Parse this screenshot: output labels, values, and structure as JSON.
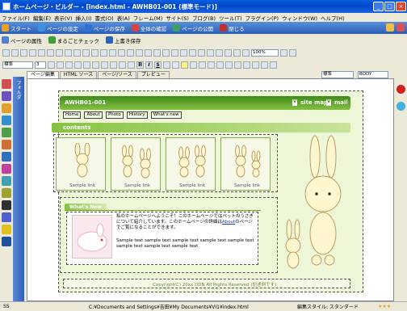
{
  "window": {
    "title": "ホームページ・ビルダー - [index.html - AWHB01-001 (標準モード)]",
    "controls": [
      "_",
      "□",
      "×"
    ]
  },
  "menu": [
    "ファイル(F)",
    "編集(E)",
    "表示(V)",
    "挿入(I)",
    "書式(O)",
    "表(A)",
    "フレーム(M)",
    "サイト(S)",
    "ブログ(B)",
    "ツール(T)",
    "プラグイン(P)",
    "ウィンドウ(W)",
    "ヘルプ(H)"
  ],
  "commands": [
    {
      "label": "スタート",
      "icon": "home-icon",
      "color": "#f0a020"
    },
    {
      "label": "ページの設定",
      "icon": "page-settings-icon",
      "color": "#4090e0"
    },
    {
      "label": "ページの保存",
      "icon": "save-icon",
      "color": "#3070d0"
    },
    {
      "label": "全体の確認",
      "icon": "preview-icon",
      "color": "#e04040"
    },
    {
      "label": "ページの公開",
      "icon": "publish-icon",
      "color": "#40a060"
    },
    {
      "label": "閉じる",
      "icon": "close-doc-icon",
      "color": "#c03030"
    }
  ],
  "commands2": [
    {
      "label": "ページの属性",
      "icon": "page-attr-icon",
      "color": "#5080d0"
    },
    {
      "label": "まるごとチェック",
      "icon": "check-icon",
      "color": "#40a040"
    },
    {
      "label": "上書き保存",
      "icon": "overwrite-save-icon",
      "color": "#3060c0"
    }
  ],
  "format": {
    "style": "標準",
    "zoom": "100%",
    "font_size": "3",
    "standard": "標準",
    "body": "BODY"
  },
  "editor_tabs": [
    "ページ編集",
    "HTML ソース",
    "ページ/ソース",
    "プレビュー"
  ],
  "side_panel": "フォルダ",
  "page": {
    "site_title": "AWHB01-001",
    "site_links": [
      "site map",
      "mail"
    ],
    "nav": [
      "Home",
      "About",
      "Photo",
      "History",
      "What's new"
    ],
    "contents_label": "contents",
    "thumb_link": "Sample link",
    "whats_new": "What's New",
    "intro": "私のホームページへようこそ！このホームページではペットのうさぎについて紹介しています。このホームページの詳細は",
    "intro_link": "About",
    "intro_end": "のページでご覧になることができます。",
    "sample_text": "Sample text sample text sample text sample text sample text sample text sample text sample text",
    "copyright": "Copyright(C) 20xx DDN All Rights Reserved (記述例です)"
  },
  "status": {
    "left": "SS",
    "path": "C:¥Documents and Settings¥吉田¥My Documents¥VI1¥index.html",
    "right": "編集スタイル: スタンダード"
  }
}
